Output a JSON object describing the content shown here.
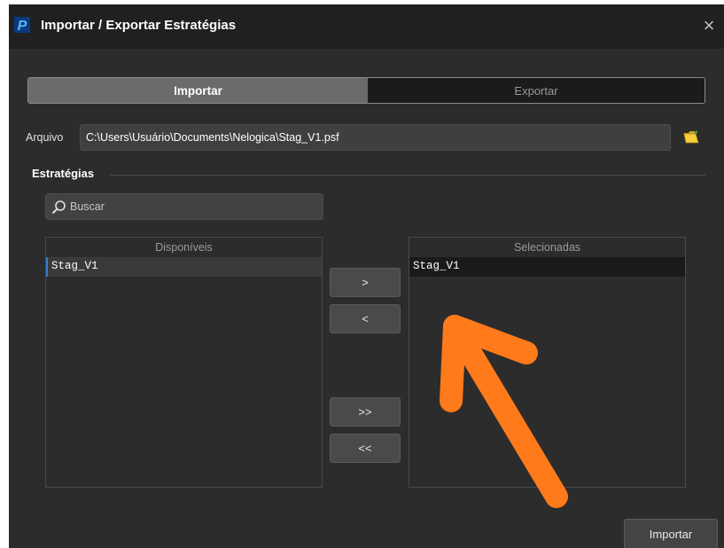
{
  "window": {
    "title": "Importar / Exportar Estratégias",
    "close_symbol": "×",
    "logo_letter": "P"
  },
  "tabs": [
    {
      "label": "Importar",
      "active": true
    },
    {
      "label": "Exportar",
      "active": false
    }
  ],
  "file": {
    "label": "Arquivo",
    "value": "C:\\Users\\Usuário\\Documents\\Nelogica\\Stag_V1.psf",
    "browse_icon": "folder-open-icon"
  },
  "strategies": {
    "section_title": "Estratégias",
    "search_placeholder": "Buscar",
    "search_icon": "search-icon",
    "available": {
      "header": "Disponíveis",
      "items": [
        "Stag_V1"
      ]
    },
    "selected": {
      "header": "Selecionadas",
      "items": [
        "Stag_V1"
      ]
    },
    "buttons": {
      "add": ">",
      "remove": "<",
      "add_all": ">>",
      "remove_all": "<<"
    }
  },
  "footer": {
    "import_label": "Importar"
  },
  "annotation": {
    "arrow_color": "#ff7a1a",
    "accent_blue": "#2f7fd6"
  }
}
